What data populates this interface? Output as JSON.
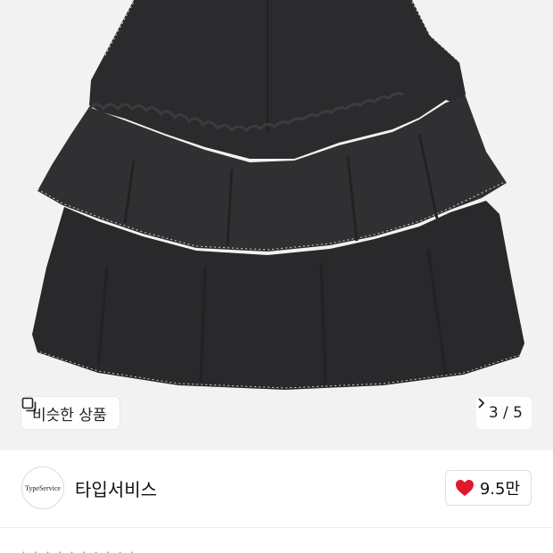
{
  "image_actions": {
    "similar_label": "비슷한 상품",
    "pager": "3 / 5"
  },
  "seller": {
    "avatar_text": "TypeService",
    "name": "타입서비스"
  },
  "like": {
    "count": "9.5만"
  },
  "description_preview": "· ·  ·  · ·  ·  ·  · · ·"
}
